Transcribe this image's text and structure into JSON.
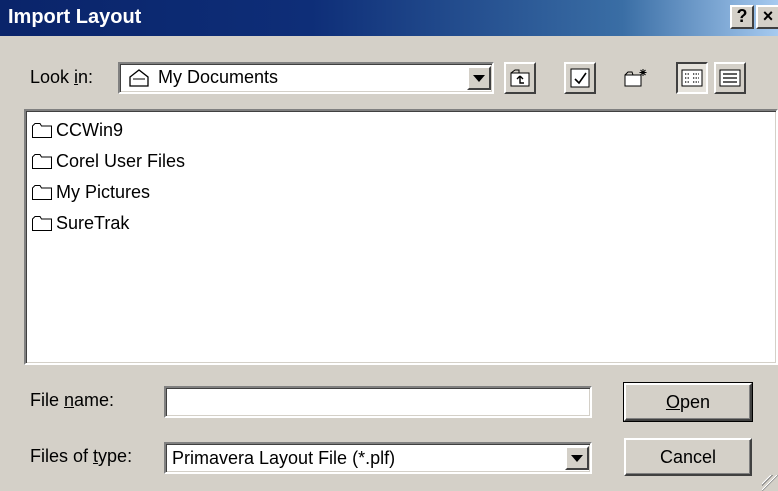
{
  "window": {
    "title": "Import Layout",
    "help_label": "?",
    "close_label": "×"
  },
  "look_in": {
    "label_pre": "Look ",
    "label_key": "i",
    "label_post": "n:",
    "value": "My Documents",
    "value_icon": "documents-folder-icon"
  },
  "toolbar": [
    {
      "name": "up-one-level-button",
      "icon": "up-folder-icon"
    },
    {
      "name": "desktop-button",
      "icon": "desktop-icon"
    },
    {
      "name": "new-folder-button",
      "icon": "new-folder-icon"
    },
    {
      "name": "list-view-button",
      "icon": "list-view-icon",
      "pressed": true
    },
    {
      "name": "details-view-button",
      "icon": "details-view-icon"
    }
  ],
  "files": [
    {
      "name": "CCWin9",
      "icon": "folder-icon"
    },
    {
      "name": "Corel User Files",
      "icon": "folder-icon"
    },
    {
      "name": "My Pictures",
      "icon": "folder-icon"
    },
    {
      "name": "SureTrak",
      "icon": "folder-icon"
    }
  ],
  "file_name": {
    "label_pre": "File ",
    "label_key": "n",
    "label_post": "ame:",
    "value": ""
  },
  "file_type": {
    "label_pre": "Files of ",
    "label_key": "t",
    "label_post": "ype:",
    "value": "Primavera Layout File (*.plf)"
  },
  "buttons": {
    "open_key": "O",
    "open_rest": "pen",
    "cancel": "Cancel"
  }
}
